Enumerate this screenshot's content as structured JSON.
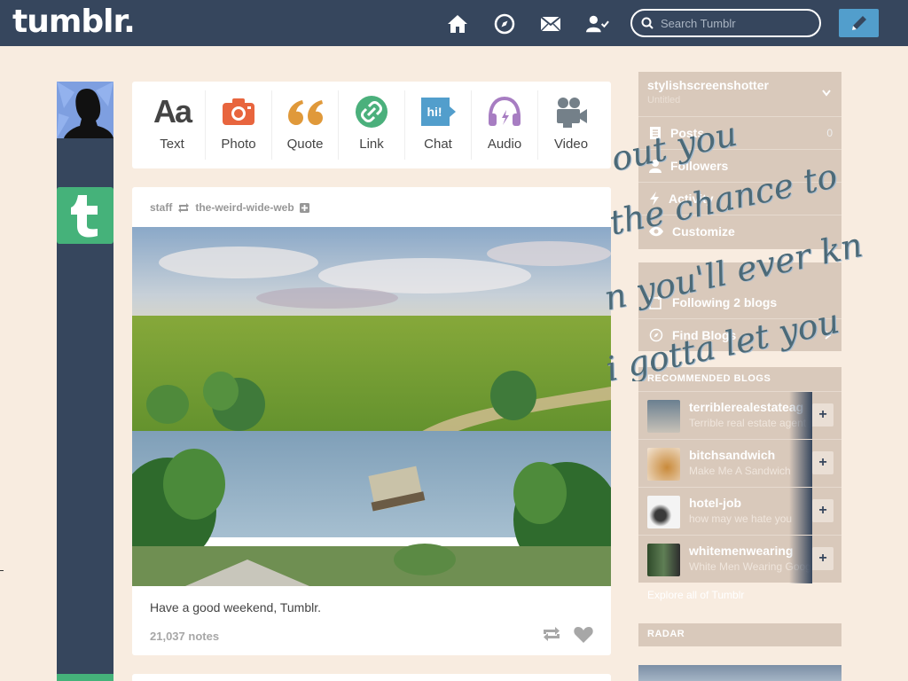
{
  "header": {
    "logo": "tumblr.",
    "search_placeholder": "Search Tumblr",
    "nav_icons": [
      "home-icon",
      "compass-icon",
      "mail-icon",
      "account-icon"
    ],
    "compose_icon": "pencil-icon"
  },
  "post_types": [
    {
      "label": "Text",
      "glyph": "Aa",
      "color": "#444444"
    },
    {
      "label": "Photo",
      "color": "#e8653e"
    },
    {
      "label": "Quote",
      "glyph": "66",
      "color": "#e0993a"
    },
    {
      "label": "Link",
      "color": "#4bb07c"
    },
    {
      "label": "Chat",
      "glyph": "hi!",
      "color": "#529ecc"
    },
    {
      "label": "Audio",
      "color": "#a77dc2"
    },
    {
      "label": "Video",
      "color": "#748089"
    }
  ],
  "post": {
    "author": "staff",
    "reblogged_from": "the-weird-wide-web",
    "caption": "Have a good weekend, Tumblr.",
    "notes": "21,037 notes"
  },
  "sidebar": {
    "blog_name": "stylishscreenshotter",
    "blog_subtitle": "Untitled",
    "blog_rows": [
      {
        "label": "Posts",
        "count": "0",
        "icon": "document-icon"
      },
      {
        "label": "Followers",
        "count": "",
        "icon": "person-icon"
      },
      {
        "label": "Activity",
        "count": "",
        "icon": "lightning-icon"
      },
      {
        "label": "Customize",
        "count": "",
        "icon": "eye-icon"
      }
    ],
    "following": "Following 2 blogs",
    "find_blogs": "Find Blogs",
    "recommended_title": "RECOMMENDED BLOGS",
    "recommended": [
      {
        "name": "terriblerealestateag",
        "desc": "Terrible real estate agent photos"
      },
      {
        "name": "bitchsandwich",
        "desc": "Make Me A Sandwich"
      },
      {
        "name": "hotel-job",
        "desc": "how may we hate you"
      },
      {
        "name": "whitemenwearing",
        "desc": "White Men Wearing Google Glass"
      }
    ],
    "explore": "Explore all of Tumblr",
    "radar_title": "RADAR"
  },
  "overlay_lines": [
    "out you",
    "the chance to",
    "n you'll ever kn",
    "i gotta let you"
  ],
  "colors": {
    "navy": "#36465d",
    "background": "#f8ece0",
    "accent": "#529ecc",
    "staff_green": "#45b27a"
  }
}
